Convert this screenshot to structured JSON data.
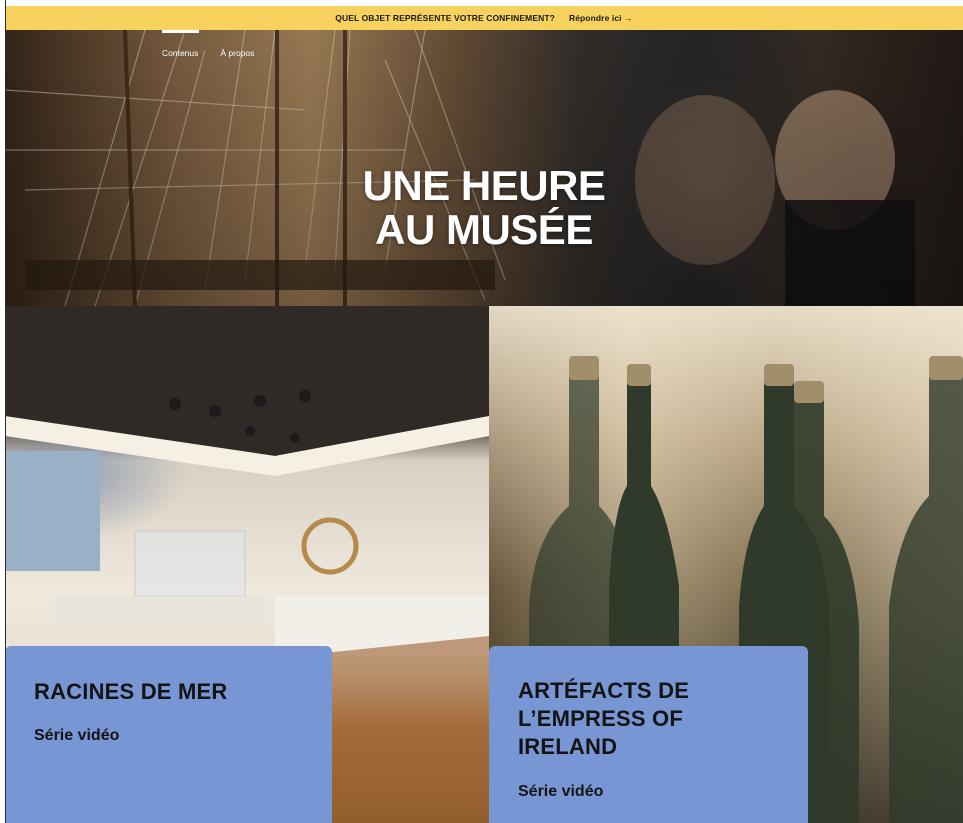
{
  "banner": {
    "question": "QUEL OBJET REPRÉSENTE VOTRE CONFINEMENT?",
    "link_label": "Répondre ici →"
  },
  "nav": {
    "items": [
      {
        "label": "Contenus",
        "active": true
      },
      {
        "label": "À propos",
        "active": false
      }
    ]
  },
  "hero": {
    "title_line1": "UNE HEURE",
    "title_line2": "AU MUSÉE"
  },
  "cards": [
    {
      "title": "RACINES DE MER",
      "subtitle": "Série vidéo"
    },
    {
      "title": "ARTÉFACTS DE L’EMPRESS OF IRELAND",
      "subtitle": "Série vidéo"
    }
  ],
  "colors": {
    "banner_bg": "#f7d25e",
    "card_label_bg": "#7896d4",
    "hero_text": "#ffffff"
  }
}
